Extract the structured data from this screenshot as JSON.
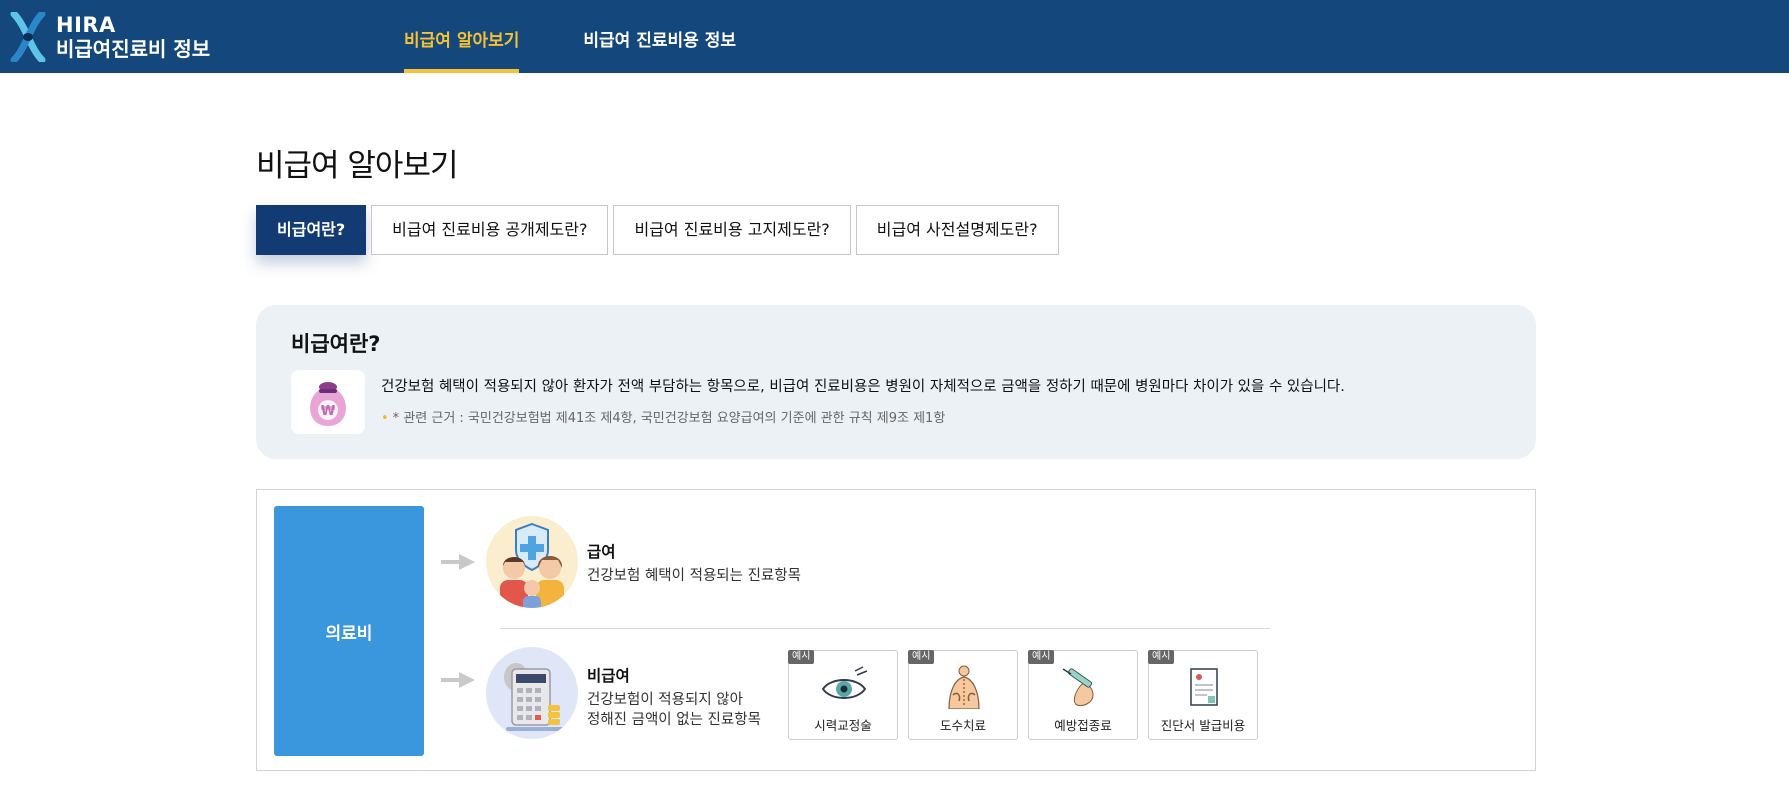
{
  "header": {
    "logo_line1": "HIRA",
    "logo_line2": "비급여진료비 정보",
    "nav": [
      {
        "label": "비급여 알아보기",
        "active": true
      },
      {
        "label": "비급여 진료비용 정보",
        "active": false
      }
    ],
    "accent_color": "#f6c233",
    "background_color": "#14477b"
  },
  "page": {
    "title": "비급여 알아보기",
    "tabs": [
      {
        "label": "비급여란?",
        "active": true
      },
      {
        "label": "비급여 진료비용 공개제도란?",
        "active": false
      },
      {
        "label": "비급여 진료비용 고지제도란?",
        "active": false
      },
      {
        "label": "비급여 사전설명제도란?",
        "active": false
      }
    ]
  },
  "info": {
    "title": "비급여란?",
    "icon": "money-bag-icon",
    "description": "건강보험 혜택이 적용되지 않아 환자가 전액 부담하는 항목으로, 비급여 진료비용은 병원이 자체적으로 금액을 정하기 때문에 병원마다 차이가 있을 수 있습니다.",
    "note": "* 관련 근거 : 국민건강보험법 제41조 제4항, 국민건강보험 요양급여의 기준에 관한 규칙 제9조 제1항"
  },
  "diagram": {
    "root_label": "의료비",
    "root_color": "#3a97dd",
    "covered": {
      "title": "급여",
      "description": "건강보험 혜택이 적용되는 진료항목",
      "icon": "family-shield-icon"
    },
    "non_covered": {
      "title": "비급여",
      "description_line1": "건강보험이 적용되지 않아",
      "description_line2": "정해진 금액이 없는 진료항목",
      "icon": "calculator-icon"
    },
    "example_badge": "예시",
    "examples": [
      {
        "label": "시력교정술",
        "icon": "eye-icon"
      },
      {
        "label": "도수치료",
        "icon": "back-therapy-icon"
      },
      {
        "label": "예방접종료",
        "icon": "syringe-icon"
      },
      {
        "label": "진단서 발급비용",
        "icon": "certificate-icon"
      }
    ]
  }
}
